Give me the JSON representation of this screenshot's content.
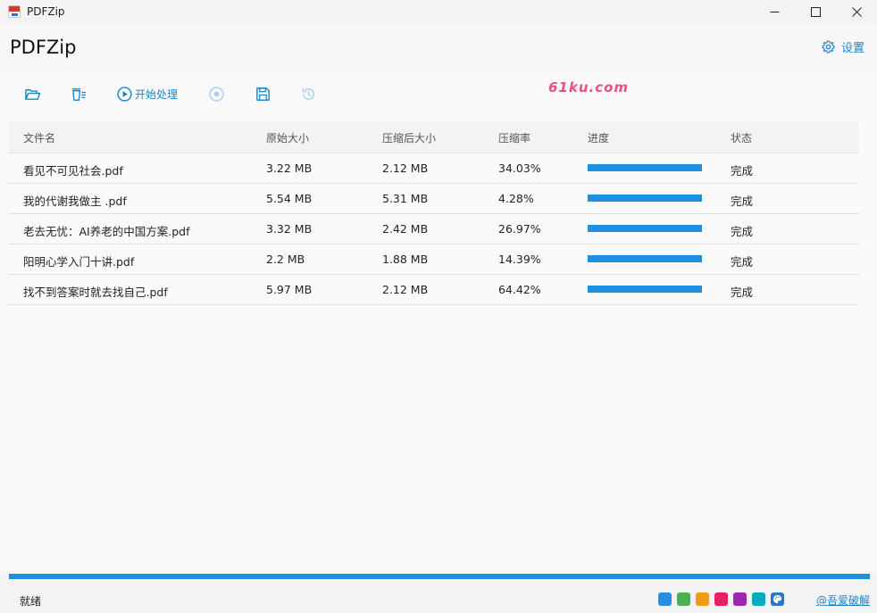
{
  "window": {
    "title": "PDFZip"
  },
  "header": {
    "title": "PDFZip",
    "settings_label": "设置"
  },
  "toolbar": {
    "open_folder_icon": "folder-open-icon",
    "clear_list_icon": "clear-list-icon",
    "start_label": "开始处理",
    "stop_icon": "stop-icon",
    "save_icon": "save-icon",
    "history_icon": "history-icon"
  },
  "table": {
    "headers": [
      "文件名",
      "原始大小",
      "压缩后大小",
      "压缩率",
      "进度",
      "状态"
    ],
    "rows": [
      {
        "name": "看见不可见社会.pdf",
        "original": "3.22 MB",
        "compressed": "2.12 MB",
        "ratio": "34.03%",
        "progress": 1.0,
        "status": "完成"
      },
      {
        "name": "我的代谢我做主 .pdf",
        "original": "5.54 MB",
        "compressed": "5.31 MB",
        "ratio": "4.28%",
        "progress": 1.0,
        "status": "完成"
      },
      {
        "name": "老去无忧：AI养老的中国方案.pdf",
        "original": "3.32 MB",
        "compressed": "2.42 MB",
        "ratio": "26.97%",
        "progress": 1.0,
        "status": "完成"
      },
      {
        "name": "阳明心学入门十讲.pdf",
        "original": "2.2 MB",
        "compressed": "1.88 MB",
        "ratio": "14.39%",
        "progress": 1.0,
        "status": "完成"
      },
      {
        "name": "找不到答案时就去找自己.pdf",
        "original": "5.97 MB",
        "compressed": "2.12 MB",
        "ratio": "64.42%",
        "progress": 1.0,
        "status": "完成"
      }
    ]
  },
  "watermark": "61ku.com",
  "overall_progress": 1.0,
  "statusbar": {
    "status": "就绪",
    "theme_colors": [
      "#2b8fe0",
      "#4caf50",
      "#f39c12",
      "#e91e63",
      "#9c27b0",
      "#00acc1"
    ],
    "credit": "@吾爱破解"
  },
  "colors": {
    "accent": "#1e90e4",
    "link": "#1d84c9"
  }
}
